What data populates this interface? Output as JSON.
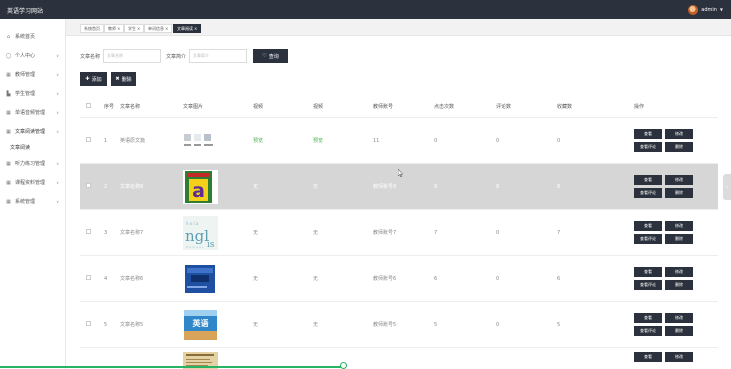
{
  "app": {
    "title": "英语学习网站"
  },
  "user": {
    "name": "admin"
  },
  "sidebar": {
    "items": [
      {
        "label": "系统首页",
        "icon": "home-icon",
        "arrow": false
      },
      {
        "label": "个人中心",
        "icon": "user-icon",
        "arrow": true
      },
      {
        "label": "教师管理",
        "icon": "grid-icon",
        "arrow": true
      },
      {
        "label": "学生管理",
        "icon": "grid-icon",
        "arrow": true
      },
      {
        "label": "单语音频管理",
        "icon": "grid-icon",
        "arrow": true
      },
      {
        "label": "文章阅读管理",
        "icon": "grid-icon",
        "arrow": true,
        "open": true
      },
      {
        "label": "文章阅读",
        "sub": true
      },
      {
        "label": "听力练习管理",
        "icon": "grid-icon",
        "arrow": true
      },
      {
        "label": "课程资料管理",
        "icon": "grid-icon",
        "arrow": true
      },
      {
        "label": "系统管理",
        "icon": "grid-icon",
        "arrow": true
      }
    ]
  },
  "tabs": [
    {
      "label": "系统首页"
    },
    {
      "label": "教师",
      "closable": true
    },
    {
      "label": "学生",
      "closable": true
    },
    {
      "label": "单词信息",
      "closable": true
    },
    {
      "label": "文章阅读",
      "closable": true,
      "active": true
    }
  ],
  "search": {
    "name_label": "文章名称",
    "name_placeholder": "文章名称",
    "intro_label": "文章简介",
    "intro_placeholder": "文章简介",
    "query_label": "查询"
  },
  "actions": {
    "add_label": "添加",
    "delete_label": "删除"
  },
  "table": {
    "columns": [
      "序号",
      "文章名称",
      "文章图片",
      "视频",
      "视频",
      "教师账号",
      "点击次数",
      "评论数",
      "收藏数",
      "操作"
    ],
    "rows": [
      {
        "index": "1",
        "name": "英语原文篇",
        "image": "worksheet",
        "video1": "预览",
        "video2": "预览",
        "teacher": "11",
        "clicks": "0",
        "comments": "0",
        "favorites": "0"
      },
      {
        "index": "2",
        "name": "文章名称8",
        "image": "letter-a",
        "video1": "无",
        "video2": "无",
        "teacher": "教师账号8",
        "clicks": "8",
        "comments": "8",
        "favorites": "8",
        "highlighted": true
      },
      {
        "index": "3",
        "name": "文章名称7",
        "image": "english-text",
        "video1": "无",
        "video2": "无",
        "teacher": "教师账号7",
        "clicks": "7",
        "comments": "0",
        "favorites": "7"
      },
      {
        "index": "4",
        "name": "文章名称6",
        "image": "blue-book",
        "video1": "无",
        "video2": "无",
        "teacher": "教师账号6",
        "clicks": "6",
        "comments": "0",
        "favorites": "6"
      },
      {
        "index": "5",
        "name": "文章名称5",
        "image": "yingyu-cover",
        "video1": "无",
        "video2": "无",
        "teacher": "教师账号5",
        "clicks": "5",
        "comments": "0",
        "favorites": "5"
      }
    ],
    "row_buttons": {
      "view": "查看",
      "edit": "修改",
      "view_comments": "查看评论",
      "delete": "删除"
    }
  },
  "colors": {
    "topbar": "#2b323d",
    "button": "#2b323d",
    "highlight_row": "#d6d6d6",
    "preview_text": "#4caf50",
    "progress": "#28b463"
  }
}
